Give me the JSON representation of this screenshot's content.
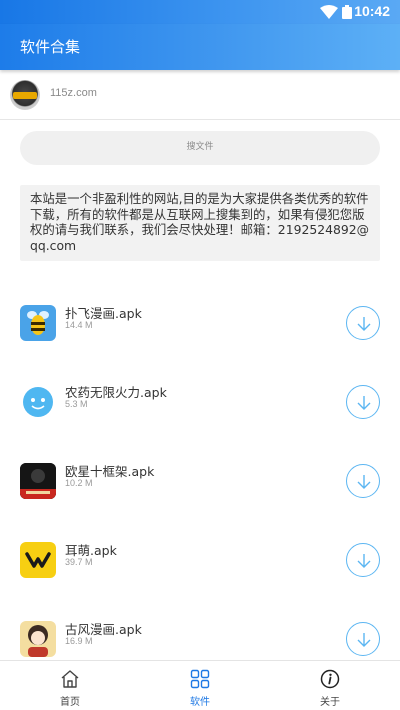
{
  "status_bar": {
    "time": "10:42"
  },
  "app_bar": {
    "title": "软件合集"
  },
  "site": {
    "name": "115z.com"
  },
  "search": {
    "label": "搜文件"
  },
  "notice": {
    "text": "本站是一个非盈利性的网站,目的是为大家提供各类优秀的软件下载，所有的软件都是从互联网上搜集到的，如果有侵犯您版权的请与我们联系，我们会尽快处理！邮箱：2192524892@qq.com"
  },
  "apps": [
    {
      "name": "扑飞漫画.apk",
      "size": "14.4 M",
      "icon": "bee-icon"
    },
    {
      "name": "农药无限火力.apk",
      "size": "5.3 M",
      "icon": "smiley-face-icon"
    },
    {
      "name": "欧星十框架.apk",
      "size": "10.2 M",
      "icon": "dark-game-icon"
    },
    {
      "name": "耳萌.apk",
      "size": "39.7 M",
      "icon": "m-logo-icon"
    },
    {
      "name": "古风漫画.apk",
      "size": "16.9 M",
      "icon": "girl-portrait-icon"
    }
  ],
  "tabs": [
    {
      "label": "首页",
      "icon": "home-icon",
      "active": false
    },
    {
      "label": "软件",
      "icon": "grid-icon",
      "active": true
    },
    {
      "label": "关于",
      "icon": "info-icon",
      "active": false
    }
  ],
  "colors": {
    "accent": "#1e78e4",
    "download_border": "#5cb6f2"
  }
}
